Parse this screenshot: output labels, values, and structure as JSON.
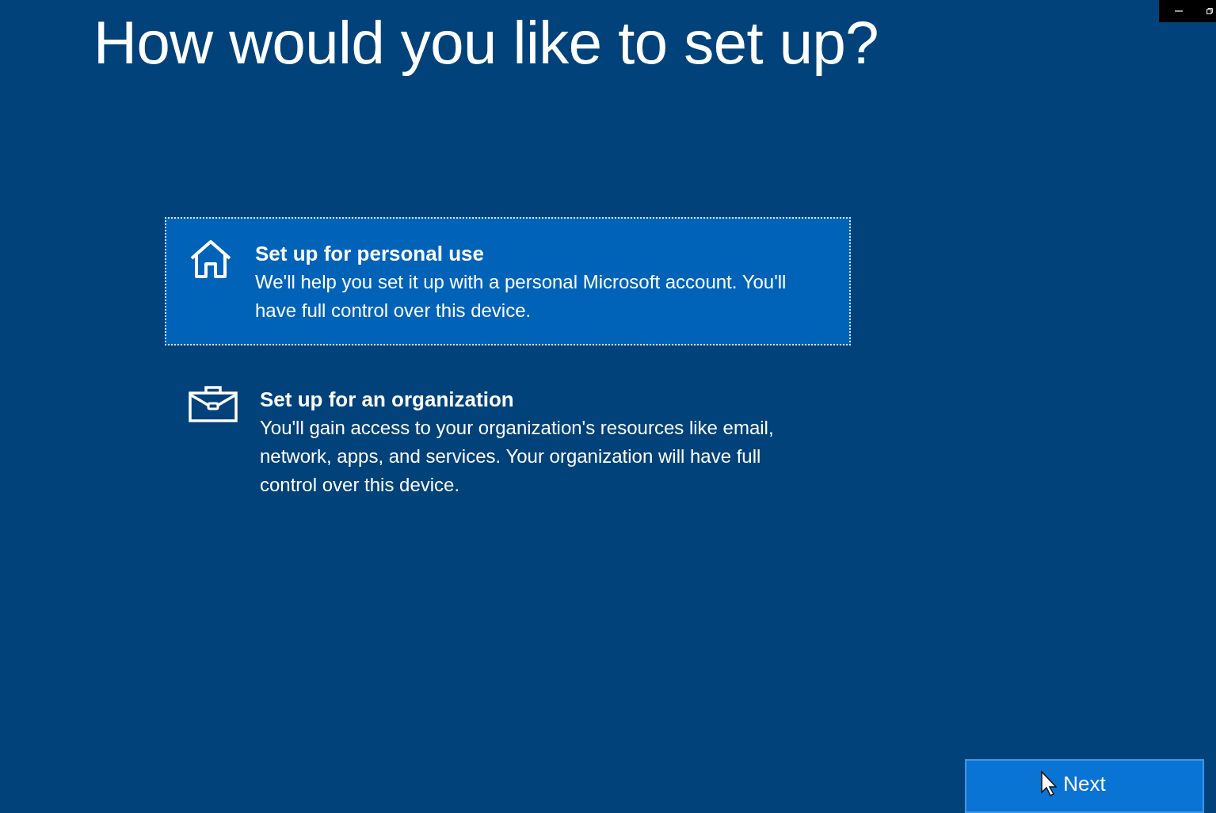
{
  "title": "How would you like to set up?",
  "options": [
    {
      "kind": "home",
      "heading": "Set up for personal use",
      "description": "We'll help you set it up with a personal Microsoft account. You'll have full control over this device.",
      "selected": true
    },
    {
      "kind": "briefcase",
      "heading": "Set up for an organization",
      "description": "You'll gain access to your organization's resources like email, network, apps, and services. Your organization will have full control over this device.",
      "selected": false
    }
  ],
  "next_button": "Next"
}
